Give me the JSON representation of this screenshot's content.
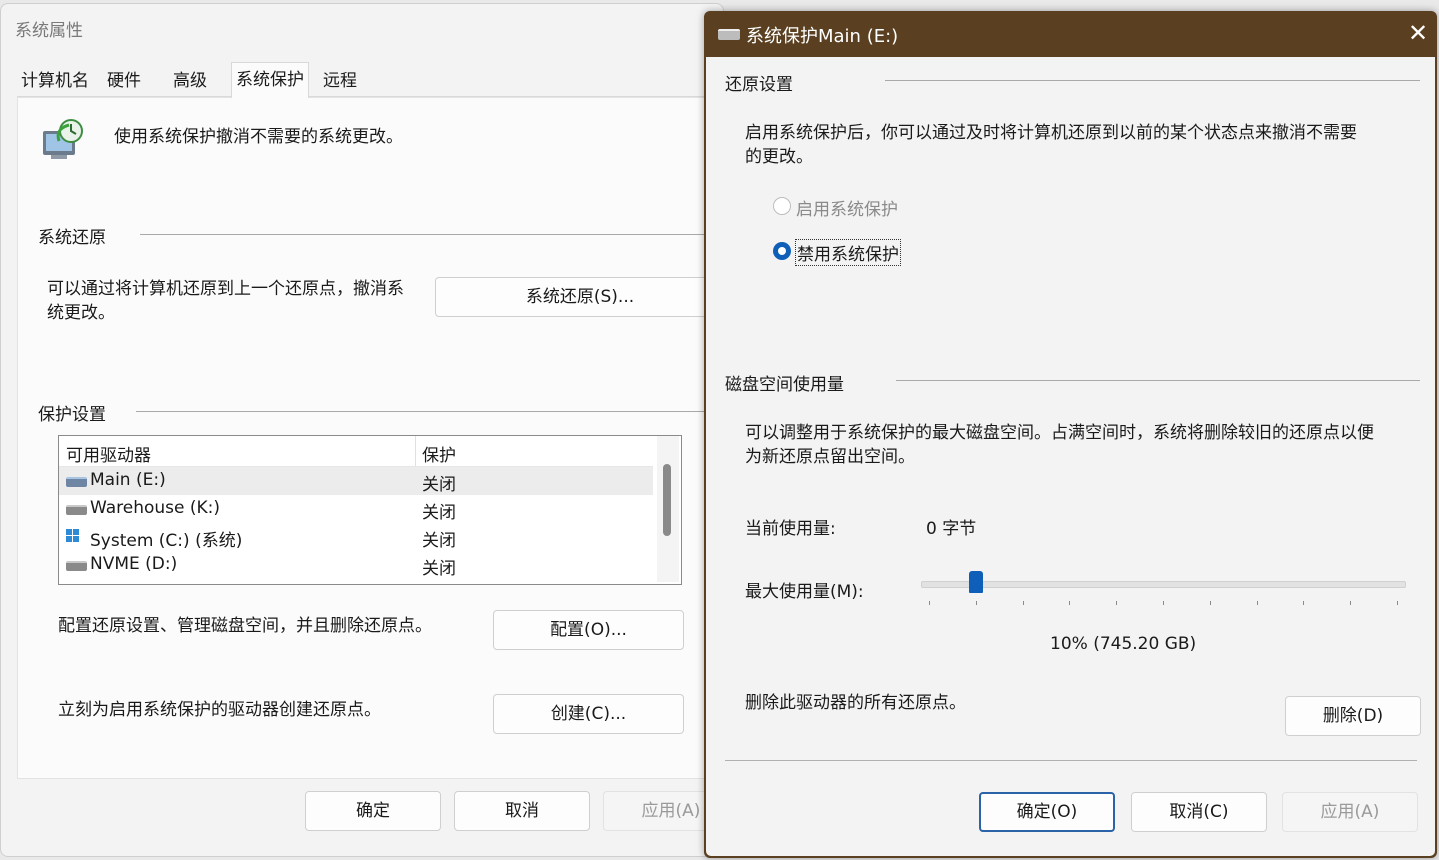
{
  "system_properties": {
    "title": "系统属性",
    "tabs": [
      "计算机名",
      "硬件",
      "高级",
      "系统保护",
      "远程"
    ],
    "selected_tab": "系统保护",
    "intro_text": "使用系统保护撤消不需要的系统更改。",
    "restore_group": {
      "title": "系统还原",
      "desc_line1": "可以通过将计算机还原到上一个还原点，撤消系",
      "desc_line2": "统更改。",
      "button": "系统还原(S)..."
    },
    "protection_group": {
      "title": "保护设置",
      "columns": [
        "可用驱动器",
        "保护"
      ],
      "drives": [
        {
          "name": "Main (E:)",
          "protection": "关闭",
          "icon": "drive-icon"
        },
        {
          "name": "Warehouse (K:)",
          "protection": "关闭",
          "icon": "drive-icon"
        },
        {
          "name": "System (C:) (系统)",
          "protection": "关闭",
          "icon": "windows-drive-icon"
        },
        {
          "name": "NVME (D:)",
          "protection": "关闭",
          "icon": "drive-icon"
        }
      ],
      "configure_text": "配置还原设置、管理磁盘空间，并且删除还原点。",
      "configure_button": "配置(O)...",
      "create_text": "立刻为启用系统保护的驱动器创建还原点。",
      "create_button": "创建(C)..."
    },
    "footer": {
      "ok": "确定",
      "cancel": "取消",
      "apply": "应用(A)"
    }
  },
  "protection_dialog": {
    "title": "系统保护Main (E:)",
    "title_bar_color": "#5a4020",
    "restore_settings": {
      "title": "还原设置",
      "desc_line1": "启用系统保护后，你可以通过及时将计算机还原到以前的某个状态点来撤消不需要",
      "desc_line2": "的更改。",
      "option_enable": "启用系统保护",
      "option_disable": "禁用系统保护",
      "selected": "禁用系统保护"
    },
    "disk_usage": {
      "title": "磁盘空间使用量",
      "desc_line1": "可以调整用于系统保护的最大磁盘空间。占满空间时，系统将删除较旧的还原点以便",
      "desc_line2": "为新还原点留出空间。",
      "current_label": "当前使用量:",
      "current_value": "0 字节",
      "max_label": "最大使用量(M):",
      "max_percent": 10,
      "max_value_text": "10% (745.20 GB)",
      "delete_text": "删除此驱动器的所有还原点。",
      "delete_button": "删除(D)"
    },
    "footer": {
      "ok": "确定(O)",
      "cancel": "取消(C)",
      "apply": "应用(A)"
    },
    "accent_color": "#0f5fb8"
  }
}
